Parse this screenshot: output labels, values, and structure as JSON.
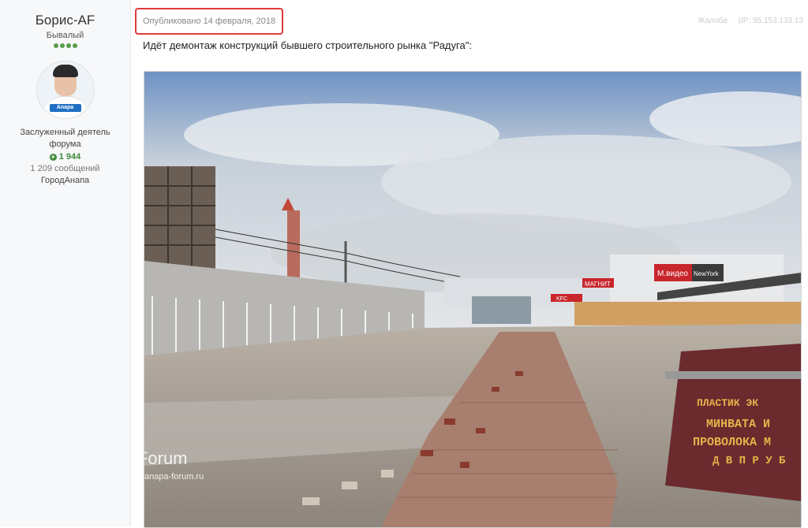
{
  "author": {
    "name": "Борис-AF",
    "rank": "Бывалый",
    "rank_pips": 4,
    "avatar_logo": "Anapa Forum",
    "title": "Заслуженный деятель форума",
    "reputation": "1 944",
    "posts": "1 209 сообщений",
    "city": "ГородАнапа"
  },
  "post": {
    "published": "Опубликовано 14 февраля, 2018",
    "ip_label": "Жалоба",
    "ip": "(IP: 95.153.133.13",
    "text": "Идёт демонтаж конструкций бывшего строительного рынка \"Радуга\":"
  },
  "photo": {
    "sign_lines": [
      "ПЛАСТИК  ЭК",
      "МИНВАТА  И",
      "ПРОВОЛОКА  М",
      "Д В П   Р У Б"
    ],
    "watermark": "Anapa-Forum",
    "watermark_url": "anapa-forum.ru",
    "building_signs": [
      "М.видео",
      "NewYork",
      "МАГНИТ",
      "KFC"
    ]
  },
  "colors": {
    "highlight_border": "#e03a3a",
    "reputation": "#3c8a3a"
  }
}
